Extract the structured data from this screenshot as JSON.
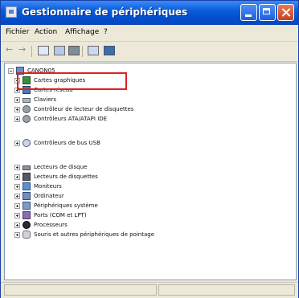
{
  "window": {
    "title": "Gestionnaire de périphériques"
  },
  "menu": [
    "Fichier",
    "Action",
    "Affichage",
    "?"
  ],
  "toolbar": {
    "icons": [
      "back-arrow-icon",
      "forward-arrow-icon",
      "properties-icon",
      "refresh-icon",
      "print-icon",
      "help-icon",
      "scan-icon"
    ]
  },
  "tree": {
    "root": "CANON05",
    "items": [
      "Cartes graphiques",
      "Cartes réseau",
      "Claviers",
      "Contrôleur de lecteur de disquettes",
      "Contrôleurs ATA/ATAPI IDE",
      "Contrôleurs de bus USB",
      "Lecteurs de disque",
      "Lecteurs de disquettes",
      "Moniteurs",
      "Ordinateur",
      "Périphériques système",
      "Ports (COM et LPT)",
      "Processeurs",
      "Souris et autres périphériques de pointage"
    ],
    "highlighted": "Contrôleurs de bus USB"
  },
  "colors": {
    "accent": "#0a5cd9",
    "highlight": "#e02020"
  }
}
